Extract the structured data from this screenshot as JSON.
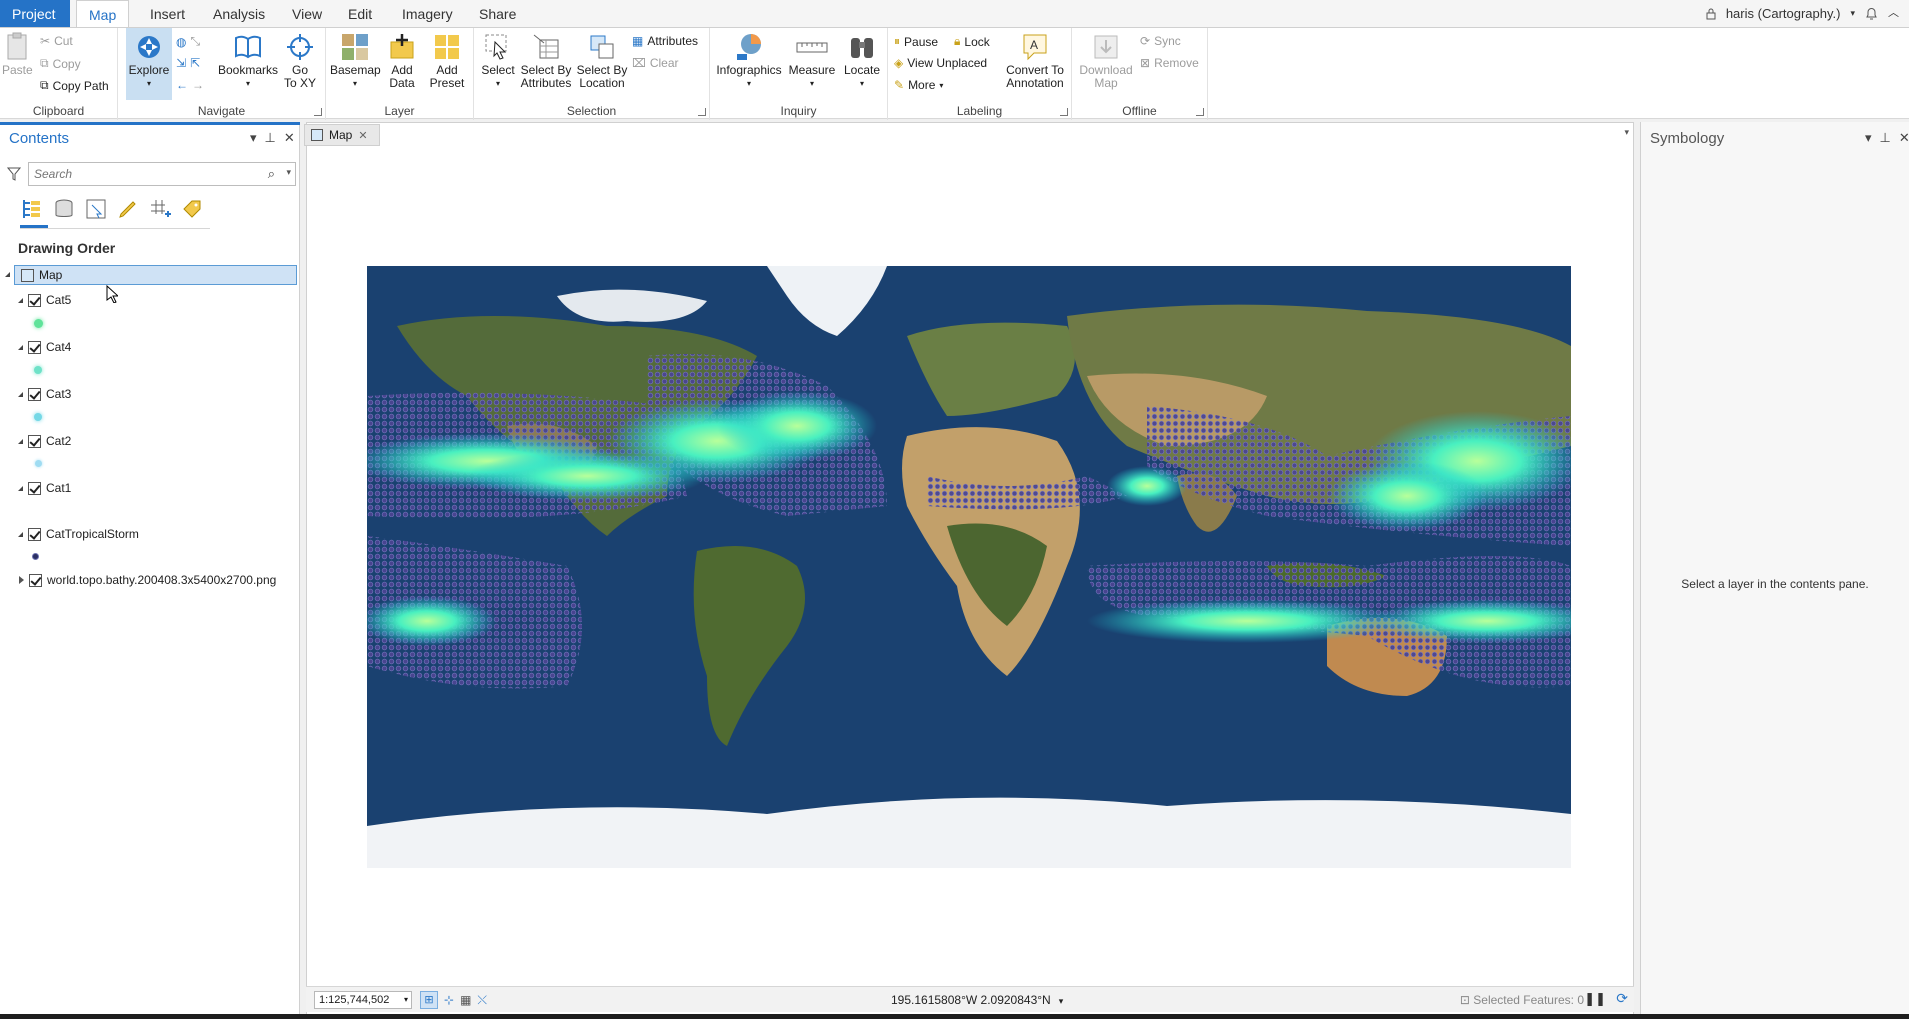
{
  "tabs": [
    "Project",
    "Map",
    "Insert",
    "Analysis",
    "View",
    "Edit",
    "Imagery",
    "Share"
  ],
  "active_tab": "Map",
  "user": "haris (Cartography.)",
  "ribbon": {
    "clipboard": {
      "paste": "Paste",
      "cut": "Cut",
      "copy": "Copy",
      "copy_path": "Copy Path",
      "label": "Clipboard"
    },
    "navigate": {
      "explore": "Explore",
      "bookmarks": "Bookmarks",
      "go_to_xy_1": "Go",
      "go_to_xy_2": "To XY",
      "label": "Navigate"
    },
    "layer": {
      "basemap": "Basemap",
      "add_data_1": "Add",
      "add_data_2": "Data",
      "add_preset_1": "Add",
      "add_preset_2": "Preset",
      "label": "Layer"
    },
    "selection": {
      "select": "Select",
      "by_attr_1": "Select By",
      "by_attr_2": "Attributes",
      "by_loc_1": "Select By",
      "by_loc_2": "Location",
      "attributes": "Attributes",
      "clear": "Clear",
      "label": "Selection"
    },
    "inquiry": {
      "infographics": "Infographics",
      "measure": "Measure",
      "locate": "Locate",
      "label": "Inquiry"
    },
    "labeling": {
      "pause": "Pause",
      "lock": "Lock",
      "view_unplaced": "View Unplaced",
      "more": "More",
      "convert_1": "Convert To",
      "convert_2": "Annotation",
      "label": "Labeling"
    },
    "offline": {
      "download_1": "Download",
      "download_2": "Map",
      "sync": "Sync",
      "remove": "Remove",
      "label": "Offline"
    }
  },
  "contents": {
    "title": "Contents",
    "search_placeholder": "Search",
    "drawing_order": "Drawing Order",
    "map_node": "Map",
    "layers": [
      {
        "name": "Cat5",
        "color": "#5fe39a"
      },
      {
        "name": "Cat4",
        "color": "#6fe2c8"
      },
      {
        "name": "Cat3",
        "color": "#74d8e6"
      },
      {
        "name": "Cat2",
        "color": "#9fdcf2"
      },
      {
        "name": "Cat1",
        "color": ""
      },
      {
        "name": "CatTropicalStorm",
        "color": "#2b2f63"
      },
      {
        "name": "world.topo.bathy.200408.3x5400x2700.png",
        "color": ""
      }
    ]
  },
  "map": {
    "tab_label": "Map",
    "scale": "1:125,744,502",
    "coordinates": "195.1615808°W 2.0920843°N",
    "selected_features": "Selected Features: 0"
  },
  "symbology": {
    "title": "Symbology",
    "message": "Select a layer in the contents pane."
  }
}
